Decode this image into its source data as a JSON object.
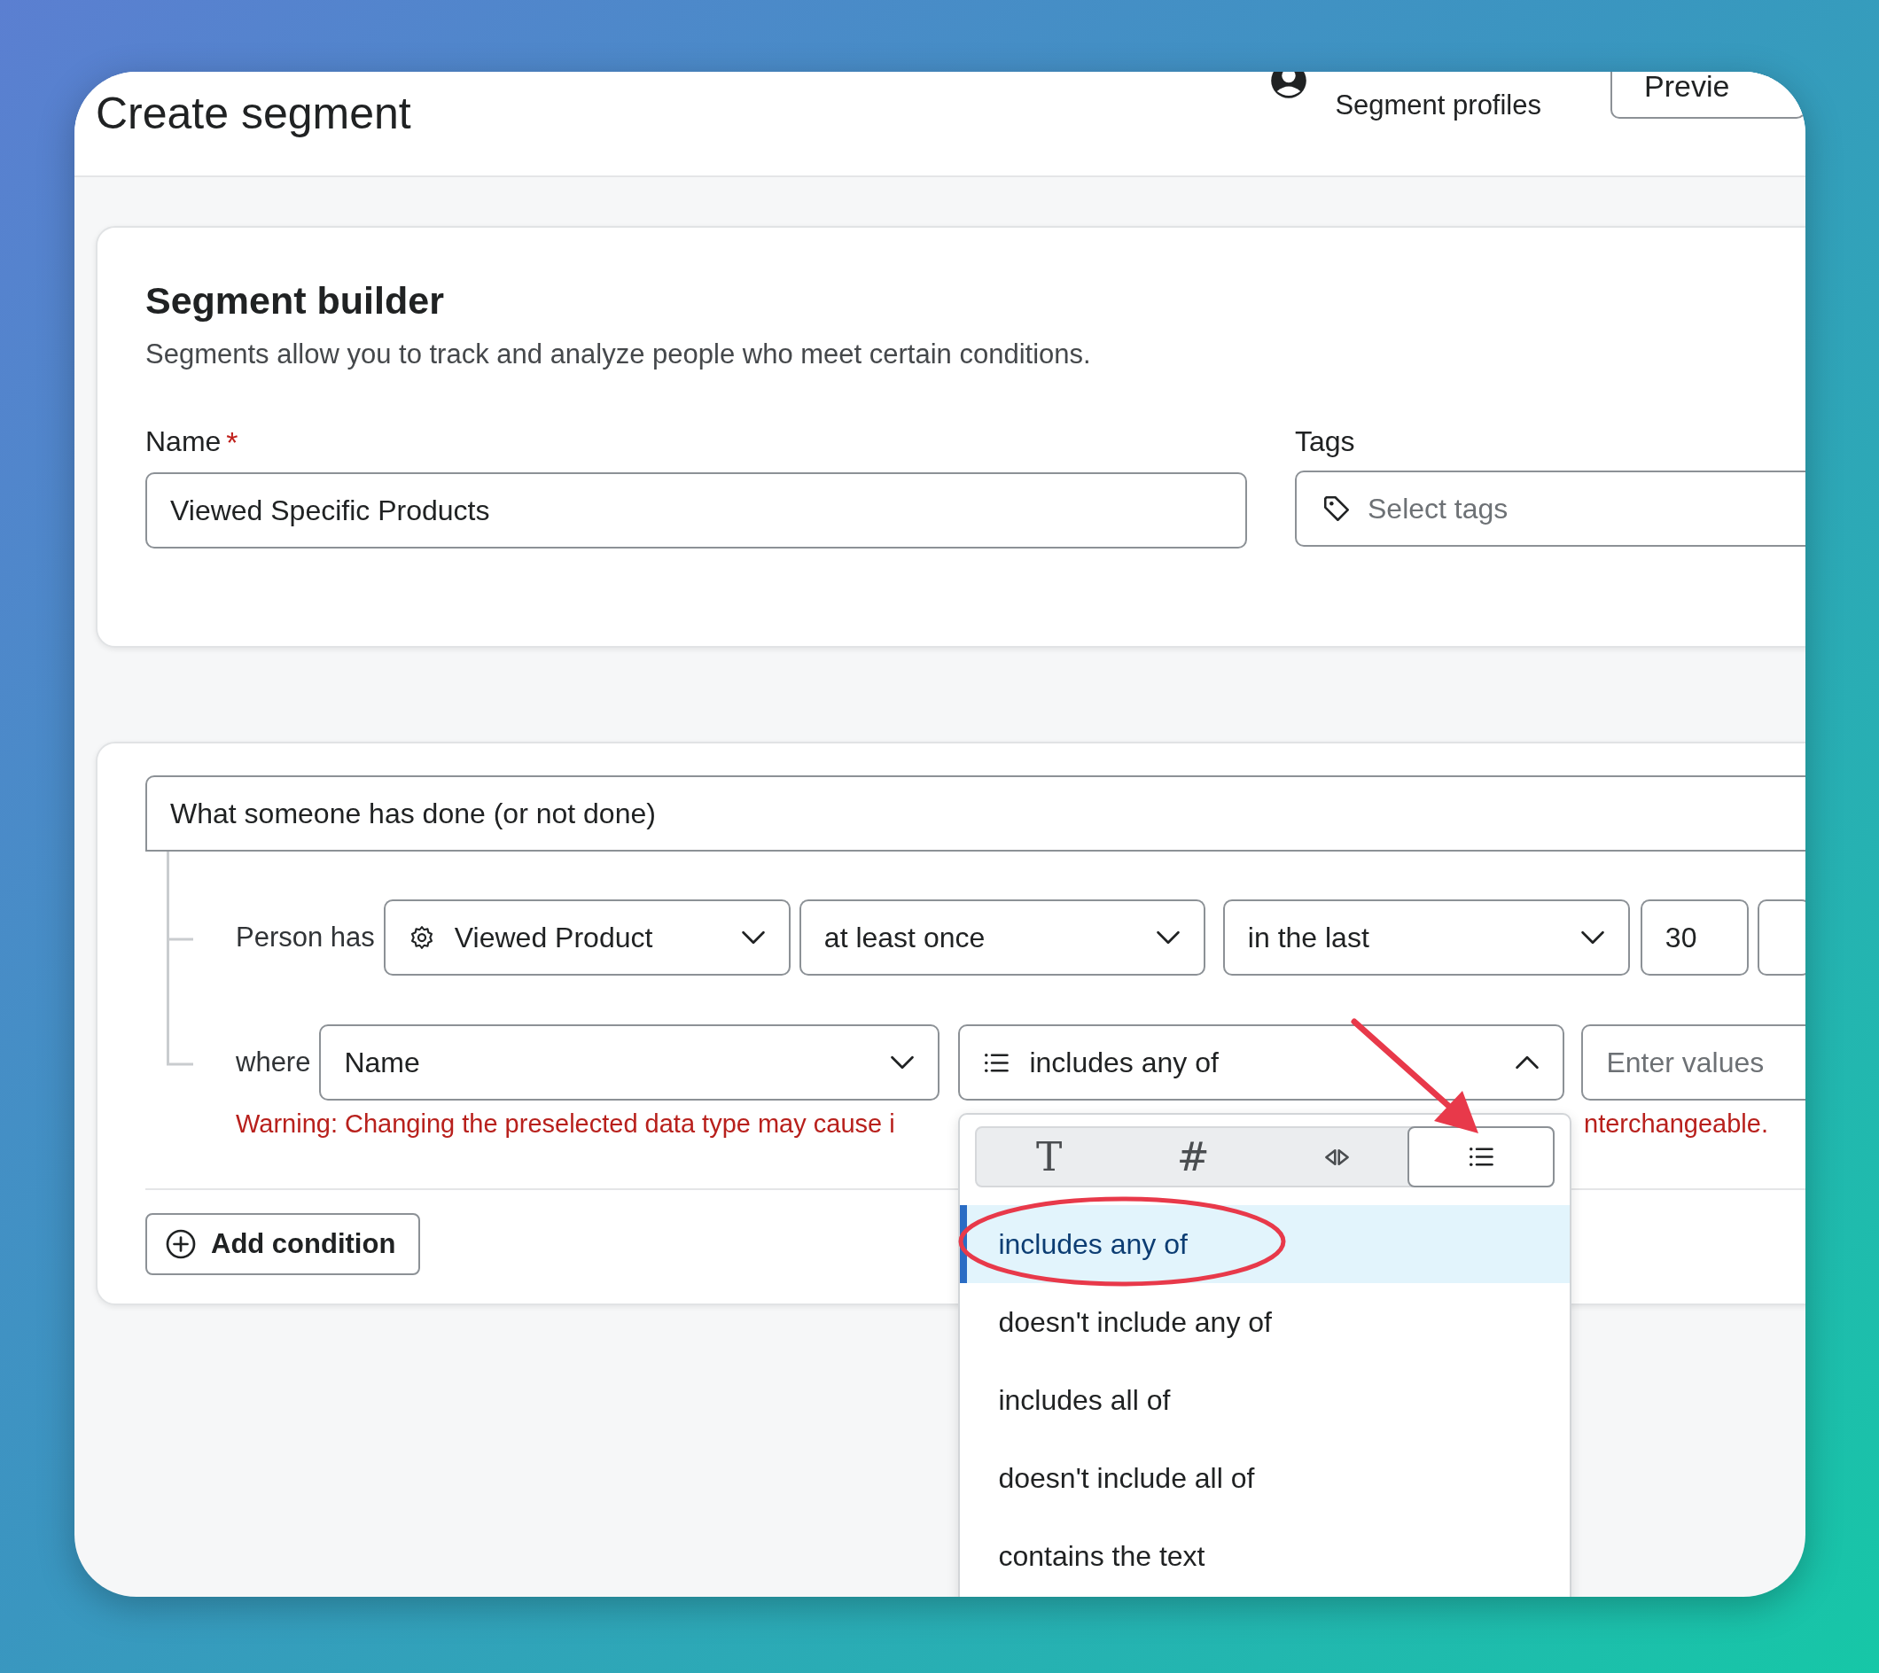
{
  "header": {
    "title": "Create segment",
    "profiles_link": "Segment profiles",
    "preview_button": "Previe"
  },
  "builder": {
    "title": "Segment builder",
    "description": "Segments allow you to track and analyze people who meet certain conditions.",
    "name_field": {
      "label": "Name",
      "required_mark": "*",
      "value": "Viewed Specific Products"
    },
    "tags_field": {
      "label": "Tags",
      "placeholder": "Select tags"
    }
  },
  "conditions": {
    "type_select": "What someone has done (or not done)",
    "person_row": {
      "label": "Person has",
      "event": "Viewed Product",
      "frequency": "at least once",
      "timeframe": "in the last",
      "amount": "30"
    },
    "where_row": {
      "label": "where",
      "property": "Name",
      "operator": "includes any of",
      "value_placeholder": "Enter values"
    },
    "warning": [
      "Warning: Changing the preselected data type may cause i",
      "nterchangeable."
    ],
    "add_button": "Add condition"
  },
  "operator_menu": {
    "expanded": true,
    "type_tabs": [
      {
        "kind": "text",
        "symbol": "T",
        "selected": false
      },
      {
        "kind": "number",
        "symbol": "#",
        "selected": false
      },
      {
        "kind": "boolean",
        "selected": false
      },
      {
        "kind": "list",
        "selected": true
      }
    ],
    "options": [
      {
        "label": "includes any of",
        "selected": true
      },
      {
        "label": "doesn't include any of",
        "selected": false
      },
      {
        "label": "includes all of",
        "selected": false
      },
      {
        "label": "doesn't include all of",
        "selected": false
      },
      {
        "label": "contains the text",
        "selected": false
      }
    ]
  }
}
